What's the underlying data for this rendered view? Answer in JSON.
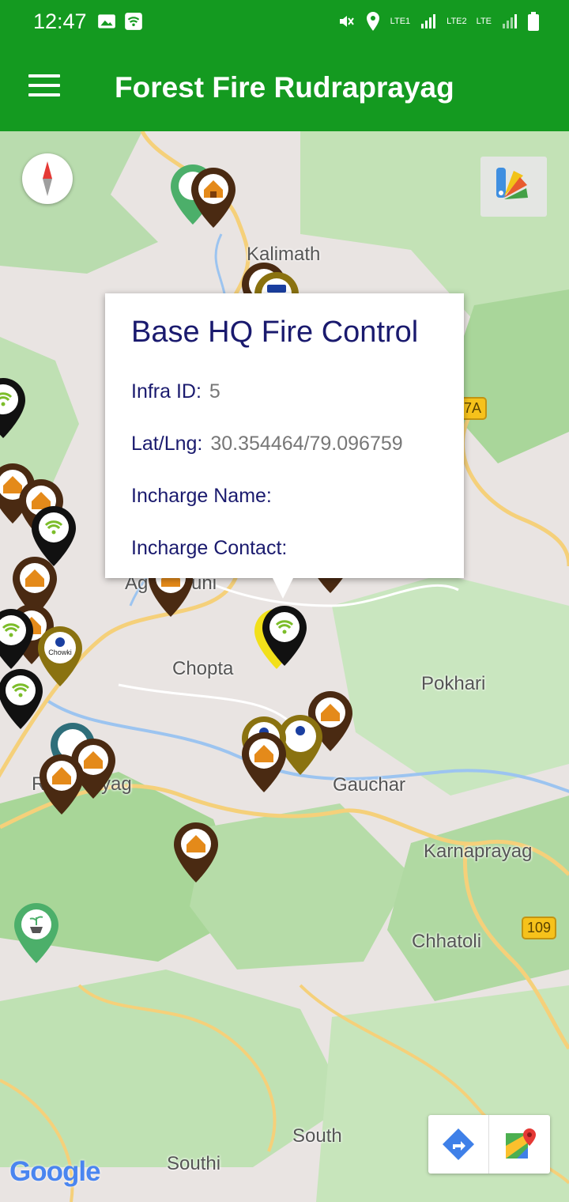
{
  "status_bar": {
    "time": "12:47",
    "sim1_label": "LTE1",
    "sim2_label": "LTE2",
    "network_type": "LTE"
  },
  "app_bar": {
    "title": "Forest Fire Rudraprayag"
  },
  "map": {
    "places": [
      "Kalimath",
      "Chopta",
      "Pokhari",
      "Gauchar",
      "Karnaprayag",
      "Chhatoli",
      "South",
      "Southi",
      "Ag",
      "uni",
      "R",
      "yag"
    ],
    "road_shields": [
      "7A",
      "109"
    ],
    "marker_labels": {
      "chowki": "Chowki",
      "police": "POLICE"
    }
  },
  "info_window": {
    "title": "Base HQ Fire Control",
    "infra_id_label": "Infra ID:",
    "infra_id_value": "5",
    "latlng_label": "Lat/Lng:",
    "latlng_value": "30.354464/79.096759",
    "incharge_name_label": "Incharge Name:",
    "incharge_name_value": "",
    "incharge_contact_label": "Incharge Contact:",
    "incharge_contact_value": ""
  },
  "attribution": "Google",
  "colors": {
    "app_bar": "#149a20",
    "hut_marker": "#4a2a12",
    "wifi_marker": "#111111",
    "chowki_marker": "#8a7210",
    "plant_marker": "#4caf6a",
    "info_text": "#1a1a6e"
  }
}
